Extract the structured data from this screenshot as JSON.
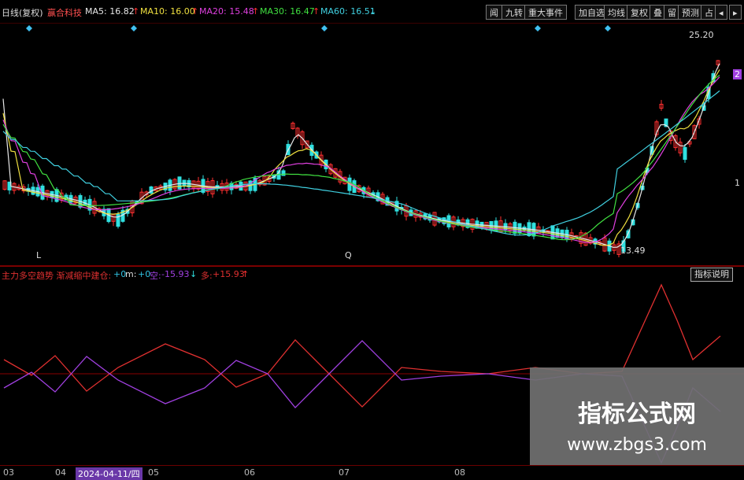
{
  "header": {
    "period": "日线(复权)",
    "stock_name": "赢合科技",
    "ma5": {
      "label": "MA5: 16.82",
      "arrow": "↑",
      "color": "#e8e8e8"
    },
    "ma10": {
      "label": "MA10: 16.00",
      "arrow": "↑",
      "color": "#f0e040"
    },
    "ma20": {
      "label": "MA20: 15.48",
      "arrow": "↑",
      "color": "#e040e0"
    },
    "ma30": {
      "label": "MA30: 16.47",
      "arrow": "↑",
      "color": "#40e040"
    },
    "ma60": {
      "label": "MA60: 16.51",
      "arrow": "↓",
      "color": "#40d0e0"
    }
  },
  "toolbar": {
    "buttons": [
      "闻",
      "九转",
      "重大事件",
      "加自选",
      "均线",
      "复权",
      "叠",
      "留",
      "预测",
      "占",
      "◂",
      "▸"
    ]
  },
  "chart": {
    "price_high": "25.20",
    "price_low": "13.49",
    "right_labels": [
      "2",
      "1"
    ],
    "marker_l": "L",
    "marker_q": "Q"
  },
  "indicator": {
    "title": "主力多空趋势 渐减缩中建仓:",
    "m_val": "+0",
    "m_label": "m:",
    "m_val2": "+0",
    "kong_label": "空:",
    "kong_val": "-15.93",
    "kong_arrow": "↓",
    "duo_label": "多:",
    "duo_val": "+15.93",
    "duo_arrow": "↑",
    "help_label": "指标说明"
  },
  "date_axis": {
    "labels": [
      "03",
      "04",
      "2024-04-11/四",
      "05",
      "06",
      "07",
      "08"
    ]
  },
  "watermark": {
    "line1": "指标公式网",
    "line2": "www.zbgs3.com"
  },
  "colors": {
    "up": "#ff3030",
    "down": "#30e0e0",
    "kong": "#a040e0",
    "duo": "#e03030"
  }
}
